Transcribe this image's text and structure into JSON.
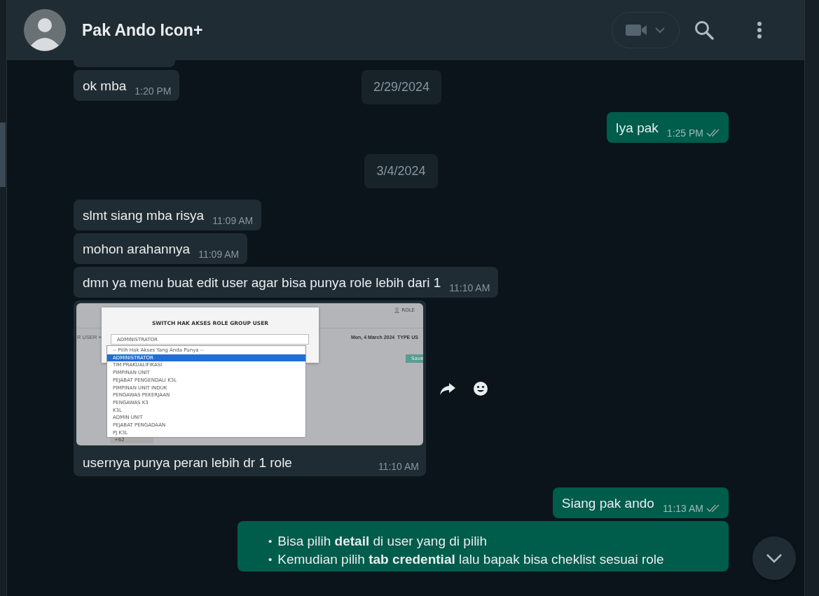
{
  "header": {
    "name": "Pak Ando Icon+"
  },
  "sticky_date": "2/29/2024",
  "messages": [
    {
      "kind": "text",
      "outgoing": false,
      "text": "ok mba",
      "time": "1:20 PM"
    },
    {
      "kind": "text",
      "outgoing": true,
      "text": "Iya pak",
      "time": "1:25 PM",
      "read": false
    },
    {
      "kind": "date",
      "text": "3/4/2024"
    },
    {
      "kind": "text",
      "outgoing": false,
      "text": "slmt siang mba risya",
      "time": "11:09 AM"
    },
    {
      "kind": "text",
      "outgoing": false,
      "text": "mohon arahannya",
      "time": "11:09 AM"
    },
    {
      "kind": "text",
      "outgoing": false,
      "text": "dmn ya menu buat edit user agar bisa punya role lebih dari 1",
      "time": "11:10 AM"
    },
    {
      "kind": "image",
      "outgoing": false,
      "caption": "usernya punya peran lebih dr 1 role",
      "time": "11:10 AM",
      "screenshot": {
        "top_link": "ROLE",
        "breadcrumb": "R USER »",
        "date": "Mon, 4 March 2024",
        "type_label": "TYPE US",
        "save": "Save",
        "phone": "+62",
        "modal_title": "SWITCH HAK AKSES ROLE GROUP USER",
        "select_value": "ADMINISTRATOR",
        "options": [
          {
            "label": "-- Pilih Hak Akses Yang Anda Punya --",
            "selected": false
          },
          {
            "label": "ADMINISTRATOR",
            "selected": true
          },
          {
            "label": "TIM PRAKUALIFIKASI",
            "selected": false
          },
          {
            "label": "PIMPINAN UNIT",
            "selected": false
          },
          {
            "label": "PEJABAT PENGENDALI K3L",
            "selected": false
          },
          {
            "label": "PIMPINAN UNIT INDUK",
            "selected": false
          },
          {
            "label": "PENGAWAS PEKERJAAN",
            "selected": false
          },
          {
            "label": "PENGAWAS K3",
            "selected": false
          },
          {
            "label": "K3L",
            "selected": false
          },
          {
            "label": "ADMIN UNIT",
            "selected": false
          },
          {
            "label": "PEJABAT PENGADAAN",
            "selected": false
          },
          {
            "label": "PJ K3L",
            "selected": false
          }
        ]
      }
    },
    {
      "kind": "text",
      "outgoing": true,
      "text": "Siang pak ando",
      "time": "11:13 AM",
      "read": false
    },
    {
      "kind": "list",
      "outgoing": true,
      "items": [
        {
          "bullet": "•",
          "text": "Bisa pilih **detail** di user yang di pilih"
        },
        {
          "bullet": "•",
          "text": "Kemudian pilih **tab credential** lalu bapak bisa cheklist sesuai role"
        }
      ]
    }
  ]
}
